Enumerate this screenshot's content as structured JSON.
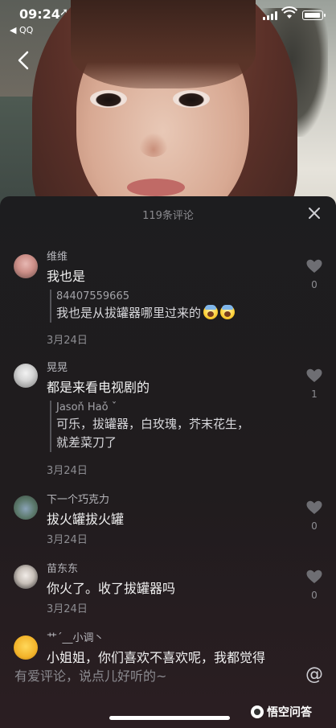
{
  "status_bar": {
    "time": "09:24",
    "back_app": "◀ QQ",
    "location_icon": "location-arrow-icon",
    "signal_bars": 4,
    "battery_level": 0.8
  },
  "sheet": {
    "title": "119条评论",
    "close_icon": "close-icon"
  },
  "comments": [
    {
      "username": "维维",
      "text": "我也是",
      "reply": {
        "user": "84407559665",
        "text": "我也是从拔罐器哪里过来的"
      },
      "date": "3月24日",
      "likes": "0"
    },
    {
      "username": "晃晃",
      "text": "都是来看电视剧的",
      "reply": {
        "user": "Jasoň Haǒ ˇ",
        "text_line1": "可乐，拔罐器，白玫瑰，芥末花生，",
        "text_line2": "就差菜刀了"
      },
      "date": "3月24日",
      "likes": "1"
    },
    {
      "username": "下一个巧克力",
      "text": "拔火罐拔火罐",
      "date": "3月24日",
      "likes": "0"
    },
    {
      "username": "苗东东",
      "text": "你火了。收了拔罐器吗",
      "date": "3月24日",
      "likes": "0"
    },
    {
      "username": "艹ˊ__小调丶",
      "text": "小姐姐，你们喜欢不喜欢呢，我都觉得"
    }
  ],
  "input": {
    "placeholder": "有爱评论，说点儿好听的~",
    "at_label": "@"
  },
  "watermark": {
    "text": "悟空问答"
  },
  "colors": {
    "sheet_bg": "#1d1d1f",
    "muted_text": "#8d8d92",
    "heart": "#6e6e73"
  }
}
